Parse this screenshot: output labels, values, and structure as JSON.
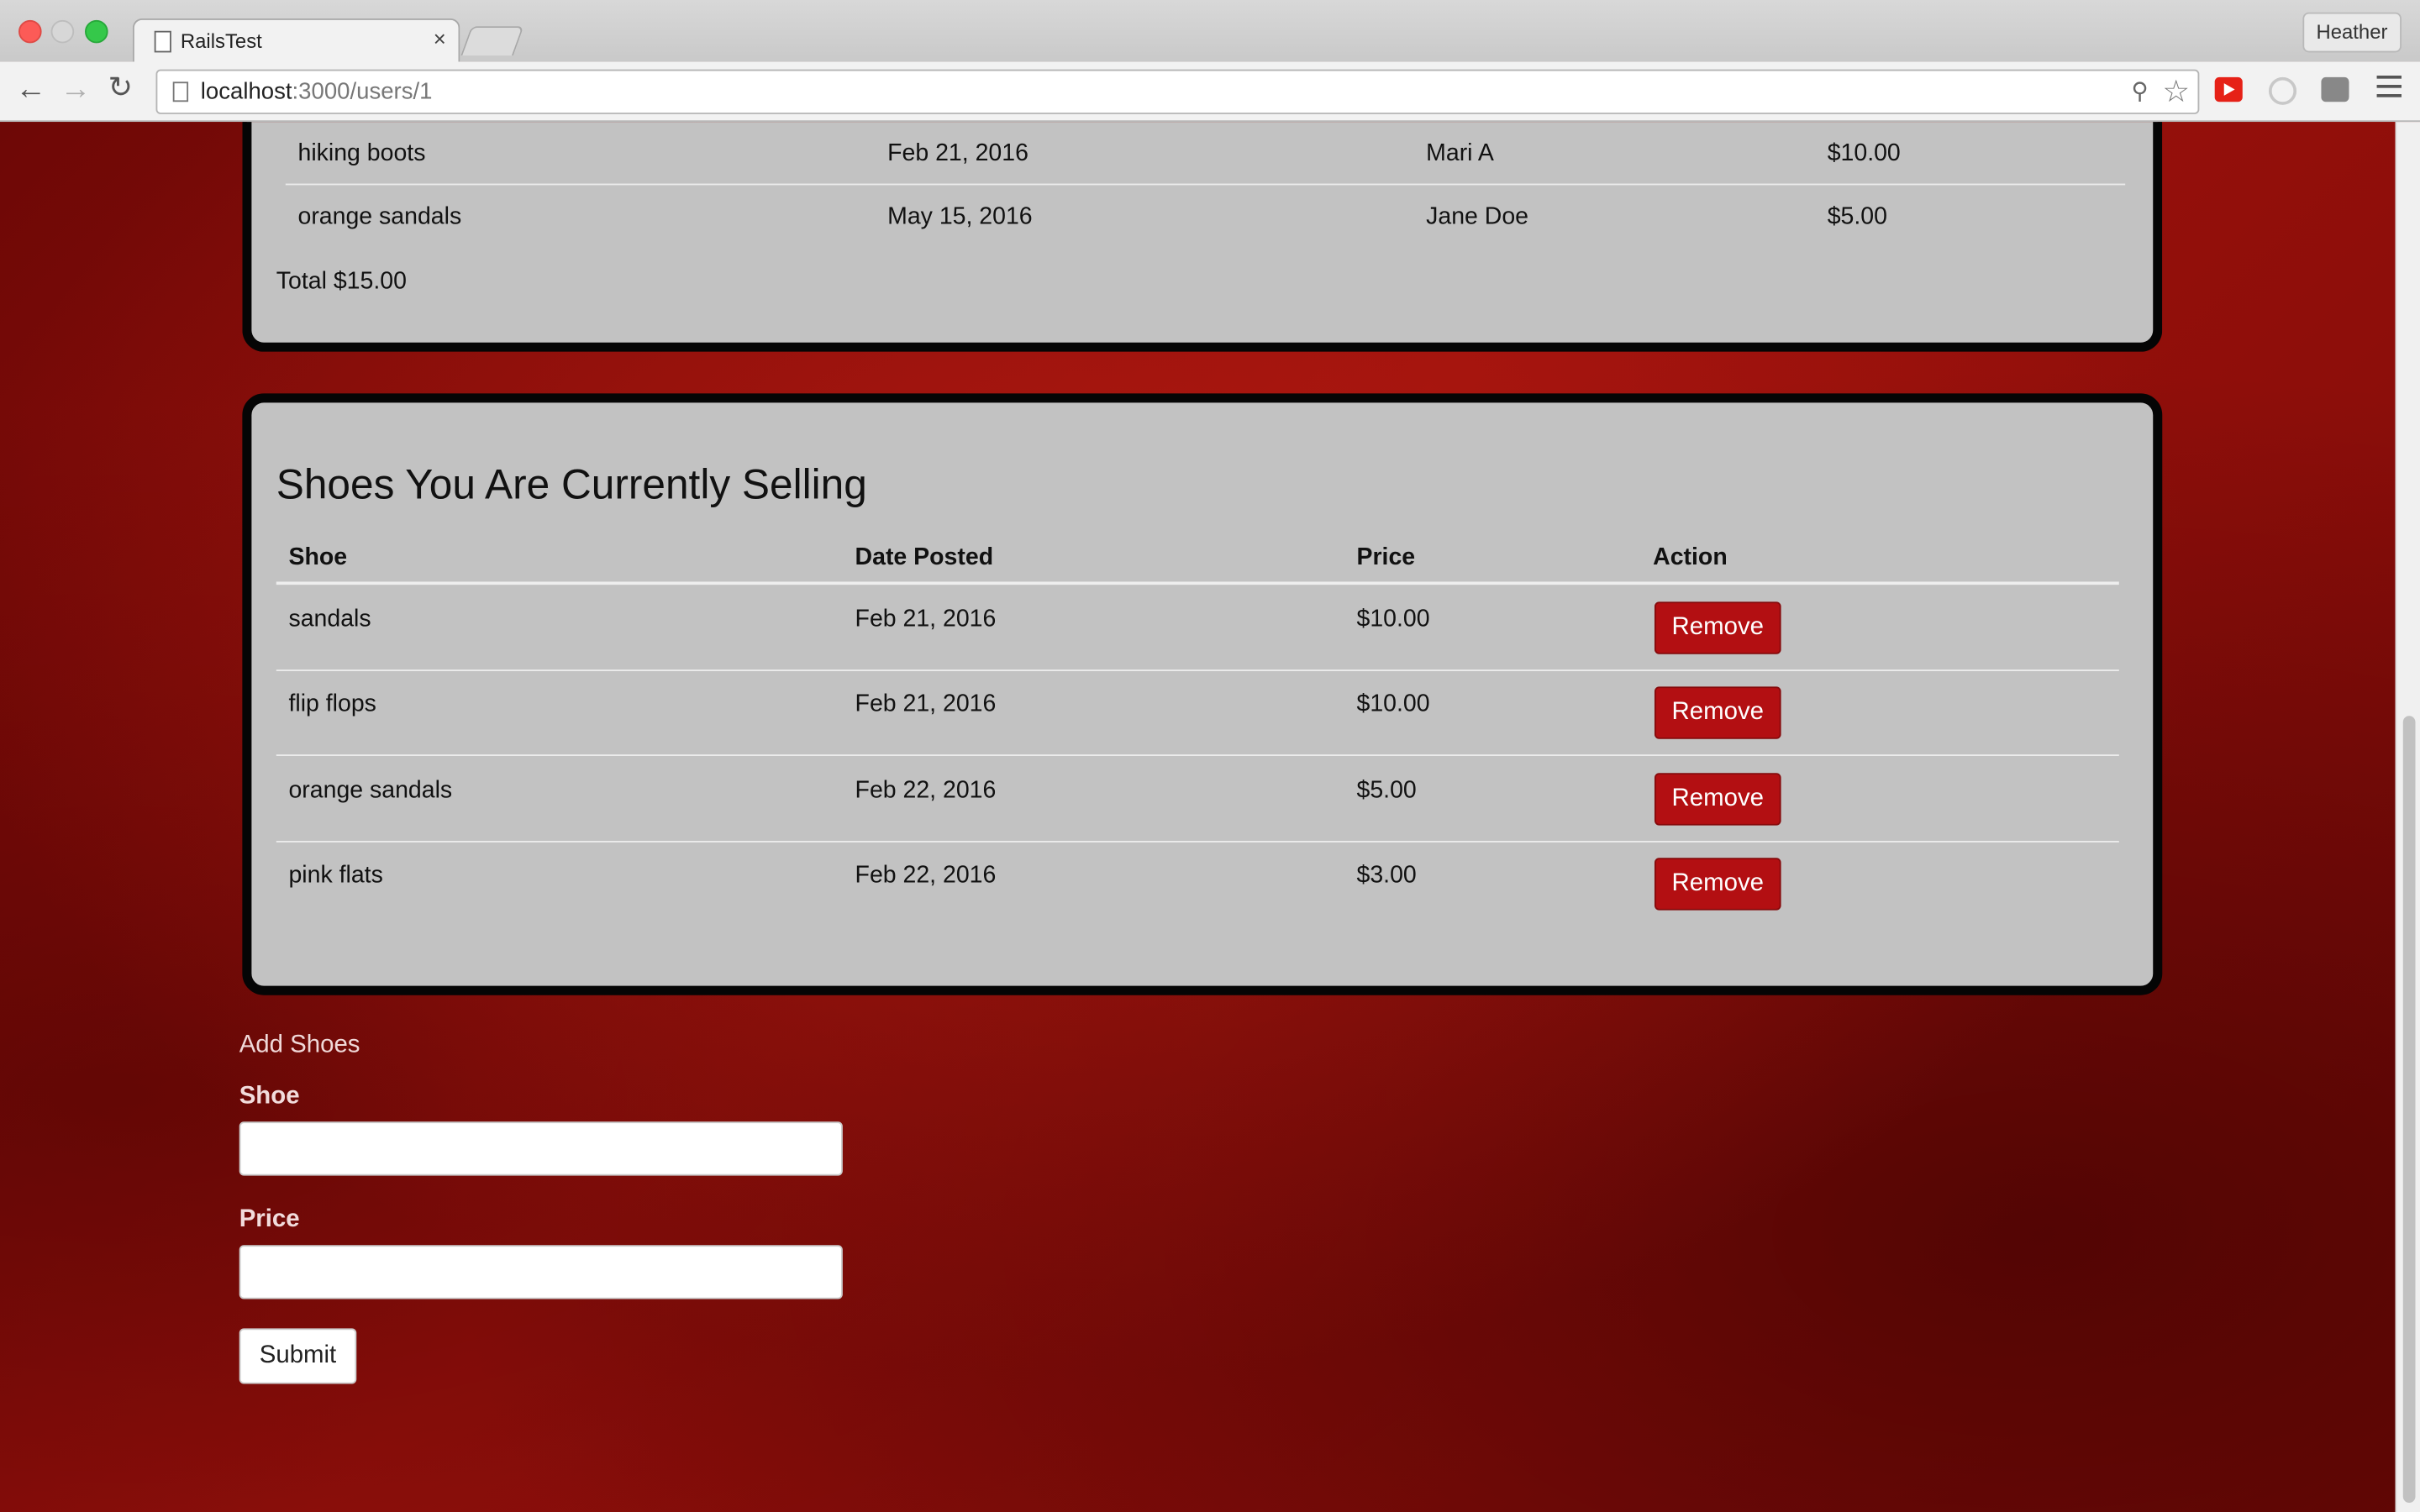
{
  "browser": {
    "tab_title": "RailsTest",
    "tab_close": "×",
    "profile_name": "Heather",
    "url_host": "localhost",
    "url_rest": ":3000/users/1",
    "icons": {
      "back": "back-arrow-icon",
      "forward": "forward-arrow-icon",
      "reload": "reload-icon",
      "star": "bookmark-star-icon",
      "key": "key-icon",
      "menu": "hamburger-menu-icon"
    }
  },
  "purchased": {
    "rows": [
      {
        "shoe": "hiking boots",
        "date": "Feb 21, 2016",
        "seller": "Mari A",
        "price": "$10.00"
      },
      {
        "shoe": "orange sandals",
        "date": "May 15, 2016",
        "seller": "Jane Doe",
        "price": "$5.00"
      }
    ],
    "total": "Total $15.00"
  },
  "selling": {
    "heading": "Shoes You Are Currently Selling",
    "columns": [
      "Shoe",
      "Date Posted",
      "Price",
      "Action"
    ],
    "rows": [
      {
        "shoe": "sandals",
        "date": "Feb 21, 2016",
        "price": "$10.00",
        "action": "Remove"
      },
      {
        "shoe": "flip flops",
        "date": "Feb 21, 2016",
        "price": "$10.00",
        "action": "Remove"
      },
      {
        "shoe": "orange sandals",
        "date": "Feb 22, 2016",
        "price": "$5.00",
        "action": "Remove"
      },
      {
        "shoe": "pink flats",
        "date": "Feb 22, 2016",
        "price": "$3.00",
        "action": "Remove"
      }
    ]
  },
  "add_form": {
    "legend": "Add Shoes",
    "shoe_label": "Shoe",
    "shoe_value": "",
    "price_label": "Price",
    "price_value": "",
    "submit_label": "Submit"
  },
  "colors": {
    "background": "#8a0b08",
    "card": "#c2c2c2",
    "card_border": "#050505",
    "remove_button": "#b30f12"
  }
}
